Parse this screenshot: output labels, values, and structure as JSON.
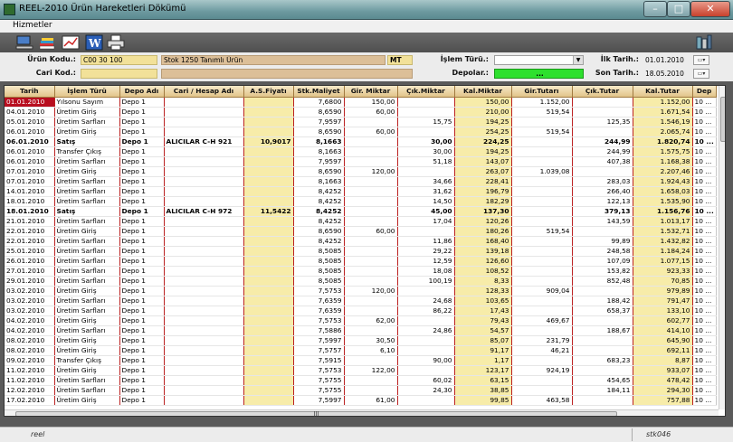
{
  "window": {
    "title": "REEL-2010 Ürün Hareketleri Dökümü"
  },
  "menu": {
    "hizmetler": "Hizmetler"
  },
  "filters": {
    "urun_kodu_label": "Ürün Kodu.:",
    "urun_kodu_value": "C00 30 100",
    "urun_adi": "Stok 1250 Tanımlı Ürün",
    "birim": "MT",
    "cari_kod_label": "Cari Kod.:",
    "cari_kod_value": "",
    "islem_turu_label": "İşlem Türü.:",
    "islem_turu_value": "",
    "depolar_label": "Depolar.:",
    "depolar_value": "...",
    "ilk_tarih_label": "İlk Tarih.:",
    "ilk_tarih_value": "01.01.2010",
    "son_tarih_label": "Son Tarih.:",
    "son_tarih_value": "18.05.2010"
  },
  "grid": {
    "headers": [
      "Tarih",
      "İşlem Türü",
      "Depo Adı",
      "Cari / Hesap Adı",
      "A.S.Fiyatı",
      "Stk.Maliyet",
      "Gir. Miktar",
      "Çık.Miktar",
      "Kal.Miktar",
      "Gir.Tutarı",
      "Çık.Tutar",
      "Kal.Tutar",
      "Dep"
    ],
    "rows": [
      [
        "01.01.2010",
        "Yılsonu Sayım",
        "Depo 1",
        "",
        "",
        "7,6800",
        "150,00",
        "",
        "150,00",
        "1.152,00",
        "",
        "1.152,00",
        "10 ..."
      ],
      [
        "04.01.2010",
        "Üretim Giriş",
        "Depo 1",
        "",
        "",
        "8,6590",
        "60,00",
        "",
        "210,00",
        "519,54",
        "",
        "1.671,54",
        "10 ..."
      ],
      [
        "05.01.2010",
        "Üretim Sarfları",
        "Depo 1",
        "",
        "",
        "7,9597",
        "",
        "15,75",
        "194,25",
        "",
        "125,35",
        "1.546,19",
        "10 ..."
      ],
      [
        "06.01.2010",
        "Üretim Giriş",
        "Depo 1",
        "",
        "",
        "8,6590",
        "60,00",
        "",
        "254,25",
        "519,54",
        "",
        "2.065,74",
        "10 ..."
      ],
      [
        "06.01.2010",
        "Satış",
        "Depo 1",
        "ALICILAR C-H 921",
        "10,9017",
        "8,1663",
        "",
        "30,00",
        "224,25",
        "",
        "244,99",
        "1.820,74",
        "10 ..."
      ],
      [
        "06.01.2010",
        "Transfer Çıkış",
        "Depo 1",
        "",
        "",
        "8,1663",
        "",
        "30,00",
        "194,25",
        "",
        "244,99",
        "1.575,75",
        "10 ..."
      ],
      [
        "06.01.2010",
        "Üretim Sarfları",
        "Depo 1",
        "",
        "",
        "7,9597",
        "",
        "51,18",
        "143,07",
        "",
        "407,38",
        "1.168,38",
        "10 ..."
      ],
      [
        "07.01.2010",
        "Üretim Giriş",
        "Depo 1",
        "",
        "",
        "8,6590",
        "120,00",
        "",
        "263,07",
        "1.039,08",
        "",
        "2.207,46",
        "10 ..."
      ],
      [
        "07.01.2010",
        "Üretim Sarfları",
        "Depo 1",
        "",
        "",
        "8,1663",
        "",
        "34,66",
        "228,41",
        "",
        "283,03",
        "1.924,43",
        "10 ..."
      ],
      [
        "14.01.2010",
        "Üretim Sarfları",
        "Depo 1",
        "",
        "",
        "8,4252",
        "",
        "31,62",
        "196,79",
        "",
        "266,40",
        "1.658,03",
        "10 ..."
      ],
      [
        "18.01.2010",
        "Üretim Sarfları",
        "Depo 1",
        "",
        "",
        "8,4252",
        "",
        "14,50",
        "182,29",
        "",
        "122,13",
        "1.535,90",
        "10 ..."
      ],
      [
        "18.01.2010",
        "Satış",
        "Depo 1",
        "ALICILAR C-H 972",
        "11,5422",
        "8,4252",
        "",
        "45,00",
        "137,30",
        "",
        "379,13",
        "1.156,76",
        "10 ..."
      ],
      [
        "21.01.2010",
        "Üretim Sarfları",
        "Depo 1",
        "",
        "",
        "8,4252",
        "",
        "17,04",
        "120,26",
        "",
        "143,59",
        "1.013,17",
        "10 ..."
      ],
      [
        "22.01.2010",
        "Üretim Giriş",
        "Depo 1",
        "",
        "",
        "8,6590",
        "60,00",
        "",
        "180,26",
        "519,54",
        "",
        "1.532,71",
        "10 ..."
      ],
      [
        "22.01.2010",
        "Üretim Sarfları",
        "Depo 1",
        "",
        "",
        "8,4252",
        "",
        "11,86",
        "168,40",
        "",
        "99,89",
        "1.432,82",
        "10 ..."
      ],
      [
        "25.01.2010",
        "Üretim Sarfları",
        "Depo 1",
        "",
        "",
        "8,5085",
        "",
        "29,22",
        "139,18",
        "",
        "248,58",
        "1.184,24",
        "10 ..."
      ],
      [
        "26.01.2010",
        "Üretim Sarfları",
        "Depo 1",
        "",
        "",
        "8,5085",
        "",
        "12,59",
        "126,60",
        "",
        "107,09",
        "1.077,15",
        "10 ..."
      ],
      [
        "27.01.2010",
        "Üretim Sarfları",
        "Depo 1",
        "",
        "",
        "8,5085",
        "",
        "18,08",
        "108,52",
        "",
        "153,82",
        "923,33",
        "10 ..."
      ],
      [
        "29.01.2010",
        "Üretim Sarfları",
        "Depo 1",
        "",
        "",
        "8,5085",
        "",
        "100,19",
        "8,33",
        "",
        "852,48",
        "70,85",
        "10 ..."
      ],
      [
        "03.02.2010",
        "Üretim Giriş",
        "Depo 1",
        "",
        "",
        "7,5753",
        "120,00",
        "",
        "128,33",
        "909,04",
        "",
        "979,89",
        "10 ..."
      ],
      [
        "03.02.2010",
        "Üretim Sarfları",
        "Depo 1",
        "",
        "",
        "7,6359",
        "",
        "24,68",
        "103,65",
        "",
        "188,42",
        "791,47",
        "10 ..."
      ],
      [
        "03.02.2010",
        "Üretim Sarfları",
        "Depo 1",
        "",
        "",
        "7,6359",
        "",
        "86,22",
        "17,43",
        "",
        "658,37",
        "133,10",
        "10 ..."
      ],
      [
        "04.02.2010",
        "Üretim Giriş",
        "Depo 1",
        "",
        "",
        "7,5753",
        "62,00",
        "",
        "79,43",
        "469,67",
        "",
        "602,77",
        "10 ..."
      ],
      [
        "04.02.2010",
        "Üretim Sarfları",
        "Depo 1",
        "",
        "",
        "7,5886",
        "",
        "24,86",
        "54,57",
        "",
        "188,67",
        "414,10",
        "10 ..."
      ],
      [
        "08.02.2010",
        "Üretim Giriş",
        "Depo 1",
        "",
        "",
        "7,5997",
        "30,50",
        "",
        "85,07",
        "231,79",
        "",
        "645,90",
        "10 ..."
      ],
      [
        "08.02.2010",
        "Üretim Giriş",
        "Depo 1",
        "",
        "",
        "7,5757",
        "6,10",
        "",
        "91,17",
        "46,21",
        "",
        "692,11",
        "10 ..."
      ],
      [
        "09.02.2010",
        "Transfer Çıkış",
        "Depo 1",
        "",
        "",
        "7,5915",
        "",
        "90,00",
        "1,17",
        "",
        "683,23",
        "8,87",
        "10 ..."
      ],
      [
        "11.02.2010",
        "Üretim Giriş",
        "Depo 1",
        "",
        "",
        "7,5753",
        "122,00",
        "",
        "123,17",
        "924,19",
        "",
        "933,07",
        "10 ..."
      ],
      [
        "11.02.2010",
        "Üretim Sarfları",
        "Depo 1",
        "",
        "",
        "7,5755",
        "",
        "60,02",
        "63,15",
        "",
        "454,65",
        "478,42",
        "10 ..."
      ],
      [
        "12.02.2010",
        "Üretim Sarfları",
        "Depo 1",
        "",
        "",
        "7,5755",
        "",
        "24,30",
        "38,85",
        "",
        "184,11",
        "294,30",
        "10 ..."
      ],
      [
        "17.02.2010",
        "Üretim Giriş",
        "Depo 1",
        "",
        "",
        "7,5997",
        "61,00",
        "",
        "99,85",
        "463,58",
        "",
        "757,88",
        "10 ..."
      ]
    ],
    "bold_rows": [
      4,
      11
    ]
  },
  "scroll": {
    "h_thumb_label": "|||"
  },
  "status": {
    "left": "reel",
    "right": "stk046"
  }
}
